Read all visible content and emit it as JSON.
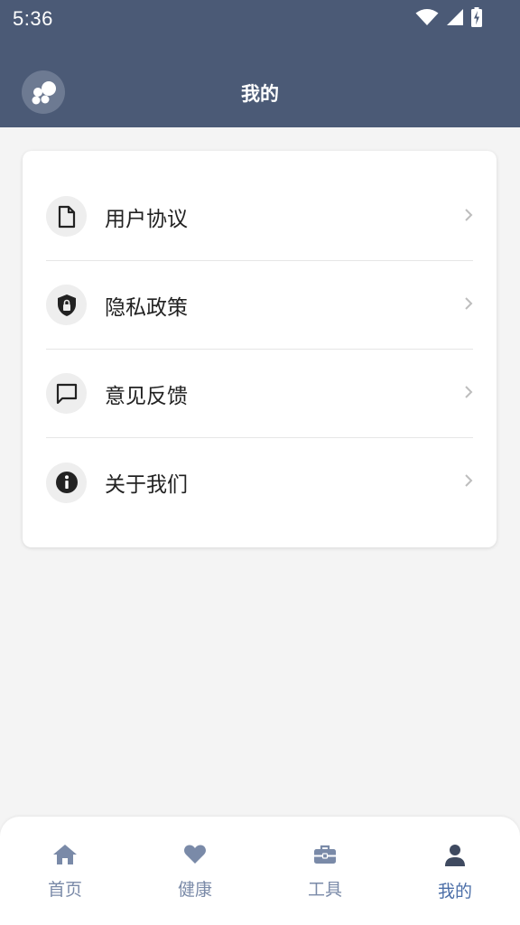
{
  "status_bar": {
    "time": "5:36"
  },
  "header": {
    "title": "我的"
  },
  "menu": {
    "items": [
      {
        "label": "用户协议",
        "icon": "document-icon"
      },
      {
        "label": "隐私政策",
        "icon": "shield-lock-icon"
      },
      {
        "label": "意见反馈",
        "icon": "chat-bubble-icon"
      },
      {
        "label": "关于我们",
        "icon": "info-icon"
      }
    ]
  },
  "bottom_nav": {
    "items": [
      {
        "label": "首页",
        "icon": "home-icon",
        "active": false
      },
      {
        "label": "健康",
        "icon": "heart-icon",
        "active": false
      },
      {
        "label": "工具",
        "icon": "toolbox-icon",
        "active": false
      },
      {
        "label": "我的",
        "icon": "person-icon",
        "active": true
      }
    ]
  },
  "colors": {
    "header_bg": "#4b5a76",
    "page_bg": "#f4f4f4",
    "nav_inactive": "#7a8aa8",
    "nav_active": "#4c6fa8"
  }
}
